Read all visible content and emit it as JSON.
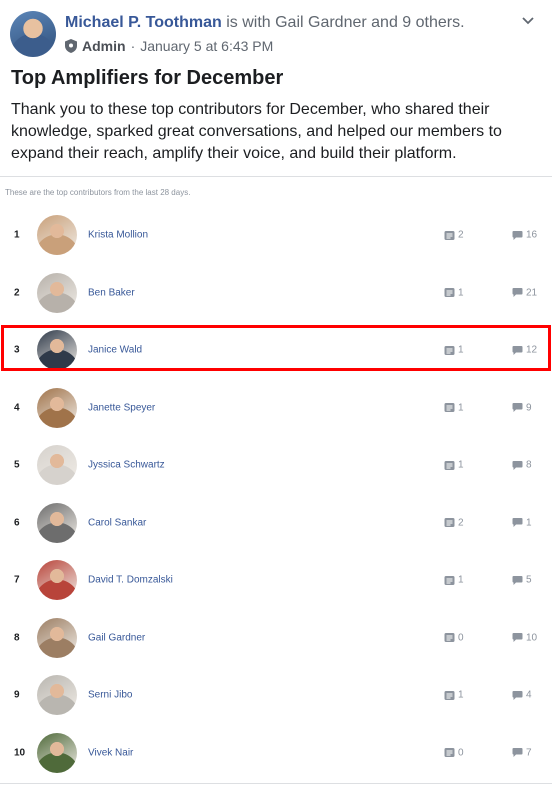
{
  "post": {
    "author": "Michael P. Toothman",
    "with_text": " is with Gail Gardner and 9 others.",
    "role": "Admin",
    "separator": "·",
    "timestamp": "January 5 at 6:43 PM",
    "title": "Top Amplifiers for December",
    "body": "Thank you to these top contributors for December, who shared their knowledge, sparked great conversations, and helped our members to expand their reach, amplify their voice, and build their platform."
  },
  "leaderboard": {
    "caption": "These are the top contributors from the last 28 days.",
    "highlighted_rank": "3",
    "rows": [
      {
        "rank": "1",
        "name": "Krista Mollion",
        "posts": "2",
        "comments": "16",
        "avatar_color": "#c9a07a"
      },
      {
        "rank": "2",
        "name": "Ben Baker",
        "posts": "1",
        "comments": "21",
        "avatar_color": "#b7b1aa"
      },
      {
        "rank": "3",
        "name": "Janice Wald",
        "posts": "1",
        "comments": "12",
        "avatar_color": "#2f3a4a"
      },
      {
        "rank": "4",
        "name": "Janette Speyer",
        "posts": "1",
        "comments": "9",
        "avatar_color": "#a0734a"
      },
      {
        "rank": "5",
        "name": "Jyssica Schwartz",
        "posts": "1",
        "comments": "8",
        "avatar_color": "#d6d2cd"
      },
      {
        "rank": "6",
        "name": "Carol Sankar",
        "posts": "2",
        "comments": "1",
        "avatar_color": "#6d6d6d"
      },
      {
        "rank": "7",
        "name": "David T. Domzalski",
        "posts": "1",
        "comments": "5",
        "avatar_color": "#b8443a"
      },
      {
        "rank": "8",
        "name": "Gail Gardner",
        "posts": "0",
        "comments": "10",
        "avatar_color": "#9c7e63"
      },
      {
        "rank": "9",
        "name": "Serni Jibo",
        "posts": "1",
        "comments": "4",
        "avatar_color": "#b9b6b0"
      },
      {
        "rank": "10",
        "name": "Vivek Nair",
        "posts": "0",
        "comments": "7",
        "avatar_color": "#4f6a3a"
      }
    ]
  },
  "colors": {
    "link": "#385898",
    "highlight_border": "#ff0000",
    "muted": "#8d949e"
  },
  "icons": {
    "post_count": "post-icon",
    "comment_count": "comment-icon",
    "admin": "shield-icon",
    "menu": "chevron-down-icon"
  }
}
